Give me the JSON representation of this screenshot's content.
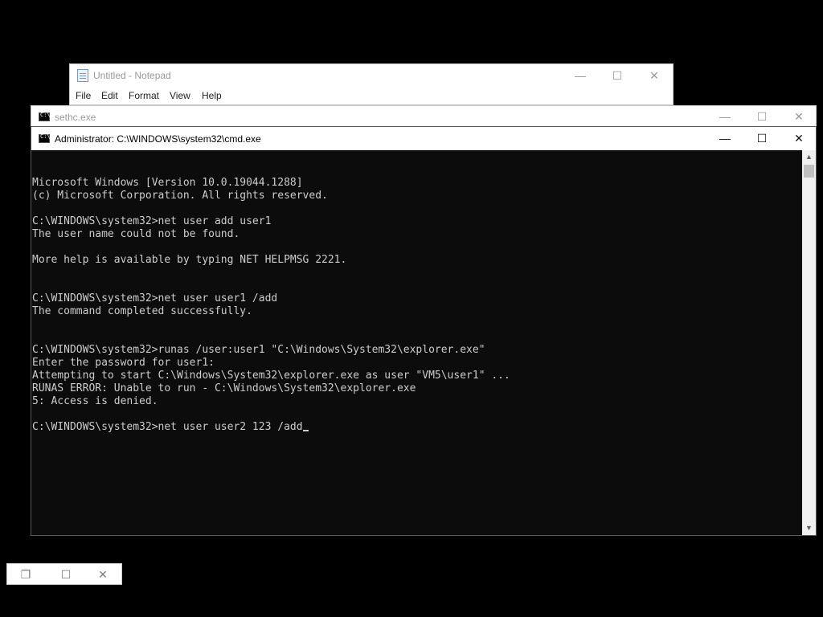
{
  "notepad": {
    "title": "Untitled - Notepad",
    "menu": [
      "File",
      "Edit",
      "Format",
      "View",
      "Help"
    ],
    "controls": {
      "minimize": "—",
      "maximize": "☐",
      "close": "✕"
    }
  },
  "sethc": {
    "title": "sethc.exe",
    "controls": {
      "minimize": "—",
      "maximize": "☐",
      "close": "✕"
    }
  },
  "cmd": {
    "title": "Administrator: C:\\WINDOWS\\system32\\cmd.exe",
    "controls": {
      "minimize": "—",
      "maximize": "☐",
      "close": "✕"
    },
    "lines": [
      "Microsoft Windows [Version 10.0.19044.1288]",
      "(c) Microsoft Corporation. All rights reserved.",
      "",
      "C:\\WINDOWS\\system32>net user add user1",
      "The user name could not be found.",
      "",
      "More help is available by typing NET HELPMSG 2221.",
      "",
      "",
      "C:\\WINDOWS\\system32>net user user1 /add",
      "The command completed successfully.",
      "",
      "",
      "C:\\WINDOWS\\system32>runas /user:user1 \"C:\\Windows\\System32\\explorer.exe\"",
      "Enter the password for user1:",
      "Attempting to start C:\\Windows\\System32\\explorer.exe as user \"VM5\\user1\" ...",
      "RUNAS ERROR: Unable to run - C:\\Windows\\System32\\explorer.exe",
      "5: Access is denied.",
      ""
    ],
    "current_input": "C:\\WINDOWS\\system32>net user user2 123 /add",
    "scroll_up": "▲",
    "scroll_down": "▼"
  },
  "minimized": {
    "controls": {
      "restore": "❐",
      "maximize": "☐",
      "close": "✕"
    }
  }
}
